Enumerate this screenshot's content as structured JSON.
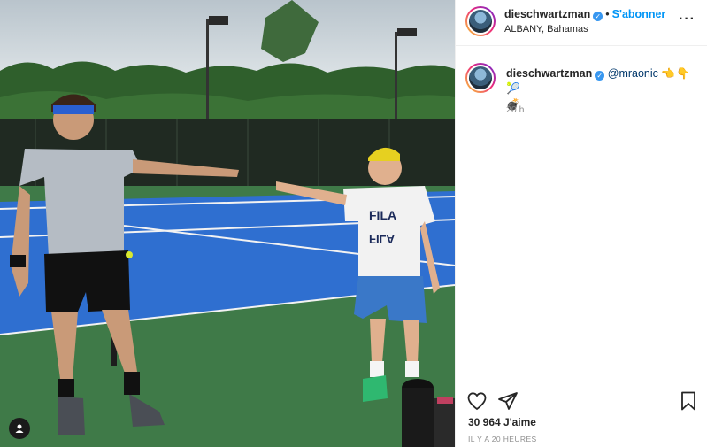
{
  "post": {
    "image_description_icon": "photo",
    "user_tag_icon": "user-icon"
  },
  "header": {
    "username": "dieschwartzman",
    "separator": "•",
    "follow_label": "S'abonner",
    "location": "ALBANY, Bahamas",
    "more_label": "···"
  },
  "caption": {
    "username": "dieschwartzman",
    "mention": "@mraonic",
    "emojis": "👈👇🎾",
    "emoji_line2": "💣",
    "age": "20 h"
  },
  "actions": {
    "like_icon": "heart-icon",
    "share_icon": "paper-plane-icon",
    "save_icon": "bookmark-icon",
    "likes": "30 964 J'aime",
    "posted": "IL Y A 20 HEURES"
  },
  "colors": {
    "link": "#0095f6",
    "verified": "#3897f0",
    "mention": "#00376b",
    "secondary_text": "#8e8e8e",
    "court_blue": "#2f6fd0",
    "court_green": "#3f7a48"
  }
}
